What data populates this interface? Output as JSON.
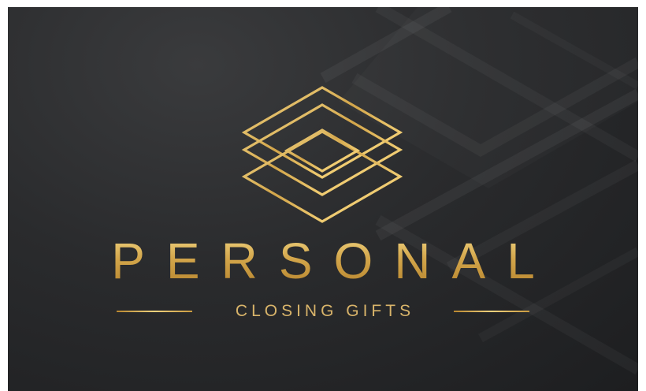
{
  "brand": {
    "title": "PERSONAL",
    "subtitle": "CLOSING GIFTS"
  },
  "colors": {
    "background": "#2a2b2d",
    "gold_light": "#f0d27e",
    "gold": "#d3a64b",
    "gold_dark": "#b8862f"
  },
  "icons": {
    "emblem": "stacked-diamonds-logo"
  }
}
